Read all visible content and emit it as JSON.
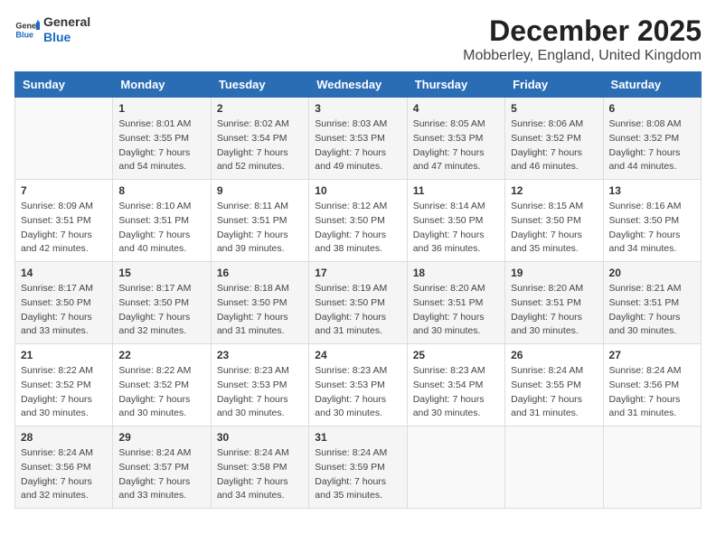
{
  "logo": {
    "line1": "General",
    "line2": "Blue"
  },
  "title": "December 2025",
  "subtitle": "Mobberley, England, United Kingdom",
  "days_of_week": [
    "Sunday",
    "Monday",
    "Tuesday",
    "Wednesday",
    "Thursday",
    "Friday",
    "Saturday"
  ],
  "weeks": [
    [
      {
        "day": "",
        "info": ""
      },
      {
        "day": "1",
        "info": "Sunrise: 8:01 AM\nSunset: 3:55 PM\nDaylight: 7 hours\nand 54 minutes."
      },
      {
        "day": "2",
        "info": "Sunrise: 8:02 AM\nSunset: 3:54 PM\nDaylight: 7 hours\nand 52 minutes."
      },
      {
        "day": "3",
        "info": "Sunrise: 8:03 AM\nSunset: 3:53 PM\nDaylight: 7 hours\nand 49 minutes."
      },
      {
        "day": "4",
        "info": "Sunrise: 8:05 AM\nSunset: 3:53 PM\nDaylight: 7 hours\nand 47 minutes."
      },
      {
        "day": "5",
        "info": "Sunrise: 8:06 AM\nSunset: 3:52 PM\nDaylight: 7 hours\nand 46 minutes."
      },
      {
        "day": "6",
        "info": "Sunrise: 8:08 AM\nSunset: 3:52 PM\nDaylight: 7 hours\nand 44 minutes."
      }
    ],
    [
      {
        "day": "7",
        "info": "Sunrise: 8:09 AM\nSunset: 3:51 PM\nDaylight: 7 hours\nand 42 minutes."
      },
      {
        "day": "8",
        "info": "Sunrise: 8:10 AM\nSunset: 3:51 PM\nDaylight: 7 hours\nand 40 minutes."
      },
      {
        "day": "9",
        "info": "Sunrise: 8:11 AM\nSunset: 3:51 PM\nDaylight: 7 hours\nand 39 minutes."
      },
      {
        "day": "10",
        "info": "Sunrise: 8:12 AM\nSunset: 3:50 PM\nDaylight: 7 hours\nand 38 minutes."
      },
      {
        "day": "11",
        "info": "Sunrise: 8:14 AM\nSunset: 3:50 PM\nDaylight: 7 hours\nand 36 minutes."
      },
      {
        "day": "12",
        "info": "Sunrise: 8:15 AM\nSunset: 3:50 PM\nDaylight: 7 hours\nand 35 minutes."
      },
      {
        "day": "13",
        "info": "Sunrise: 8:16 AM\nSunset: 3:50 PM\nDaylight: 7 hours\nand 34 minutes."
      }
    ],
    [
      {
        "day": "14",
        "info": "Sunrise: 8:17 AM\nSunset: 3:50 PM\nDaylight: 7 hours\nand 33 minutes."
      },
      {
        "day": "15",
        "info": "Sunrise: 8:17 AM\nSunset: 3:50 PM\nDaylight: 7 hours\nand 32 minutes."
      },
      {
        "day": "16",
        "info": "Sunrise: 8:18 AM\nSunset: 3:50 PM\nDaylight: 7 hours\nand 31 minutes."
      },
      {
        "day": "17",
        "info": "Sunrise: 8:19 AM\nSunset: 3:50 PM\nDaylight: 7 hours\nand 31 minutes."
      },
      {
        "day": "18",
        "info": "Sunrise: 8:20 AM\nSunset: 3:51 PM\nDaylight: 7 hours\nand 30 minutes."
      },
      {
        "day": "19",
        "info": "Sunrise: 8:20 AM\nSunset: 3:51 PM\nDaylight: 7 hours\nand 30 minutes."
      },
      {
        "day": "20",
        "info": "Sunrise: 8:21 AM\nSunset: 3:51 PM\nDaylight: 7 hours\nand 30 minutes."
      }
    ],
    [
      {
        "day": "21",
        "info": "Sunrise: 8:22 AM\nSunset: 3:52 PM\nDaylight: 7 hours\nand 30 minutes."
      },
      {
        "day": "22",
        "info": "Sunrise: 8:22 AM\nSunset: 3:52 PM\nDaylight: 7 hours\nand 30 minutes."
      },
      {
        "day": "23",
        "info": "Sunrise: 8:23 AM\nSunset: 3:53 PM\nDaylight: 7 hours\nand 30 minutes."
      },
      {
        "day": "24",
        "info": "Sunrise: 8:23 AM\nSunset: 3:53 PM\nDaylight: 7 hours\nand 30 minutes."
      },
      {
        "day": "25",
        "info": "Sunrise: 8:23 AM\nSunset: 3:54 PM\nDaylight: 7 hours\nand 30 minutes."
      },
      {
        "day": "26",
        "info": "Sunrise: 8:24 AM\nSunset: 3:55 PM\nDaylight: 7 hours\nand 31 minutes."
      },
      {
        "day": "27",
        "info": "Sunrise: 8:24 AM\nSunset: 3:56 PM\nDaylight: 7 hours\nand 31 minutes."
      }
    ],
    [
      {
        "day": "28",
        "info": "Sunrise: 8:24 AM\nSunset: 3:56 PM\nDaylight: 7 hours\nand 32 minutes."
      },
      {
        "day": "29",
        "info": "Sunrise: 8:24 AM\nSunset: 3:57 PM\nDaylight: 7 hours\nand 33 minutes."
      },
      {
        "day": "30",
        "info": "Sunrise: 8:24 AM\nSunset: 3:58 PM\nDaylight: 7 hours\nand 34 minutes."
      },
      {
        "day": "31",
        "info": "Sunrise: 8:24 AM\nSunset: 3:59 PM\nDaylight: 7 hours\nand 35 minutes."
      },
      {
        "day": "",
        "info": ""
      },
      {
        "day": "",
        "info": ""
      },
      {
        "day": "",
        "info": ""
      }
    ]
  ]
}
